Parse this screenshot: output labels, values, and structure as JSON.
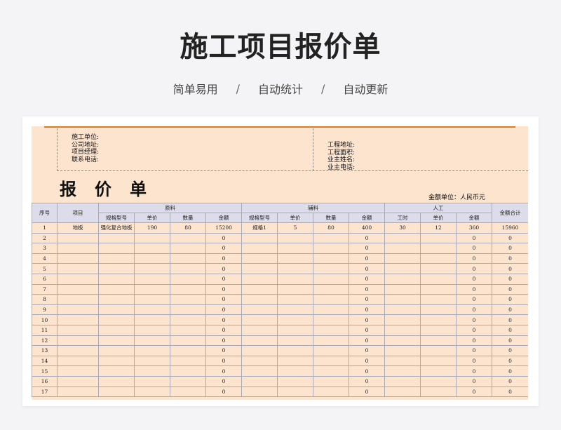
{
  "header": {
    "title": "施工项目报价单",
    "features": [
      "简单易用",
      "自动统计",
      "自动更新"
    ],
    "separator": "/"
  },
  "sheet": {
    "info_left": [
      "施工单位:",
      "公司地址:",
      "项目经理:",
      "联系电话:"
    ],
    "info_right": [
      "工程地址:",
      "工程面积:",
      "业主姓名:",
      "业主电话:"
    ],
    "doc_title": "报价单",
    "currency_unit": "金额单位：人民币元",
    "table": {
      "group_headers": {
        "no": "序号",
        "item": "项目",
        "material": "原料",
        "auxiliary": "辅料",
        "labor": "人工",
        "total": "金额合计"
      },
      "sub_headers": {
        "material": [
          "规格型号",
          "单价",
          "数量",
          "金额"
        ],
        "auxiliary": [
          "规格型号",
          "单价",
          "数量",
          "金额"
        ],
        "labor": [
          "工时",
          "单价",
          "金额"
        ]
      },
      "rows": [
        [
          "1",
          "地板",
          "强化复合地板",
          "190",
          "80",
          "15200",
          "规格1",
          "5",
          "80",
          "400",
          "30",
          "12",
          "360",
          "15960"
        ],
        [
          "2",
          "",
          "",
          "",
          "",
          "0",
          "",
          "",
          "",
          "0",
          "",
          "",
          "0",
          "0"
        ],
        [
          "3",
          "",
          "",
          "",
          "",
          "0",
          "",
          "",
          "",
          "0",
          "",
          "",
          "0",
          "0"
        ],
        [
          "4",
          "",
          "",
          "",
          "",
          "0",
          "",
          "",
          "",
          "0",
          "",
          "",
          "0",
          "0"
        ],
        [
          "5",
          "",
          "",
          "",
          "",
          "0",
          "",
          "",
          "",
          "0",
          "",
          "",
          "0",
          "0"
        ],
        [
          "6",
          "",
          "",
          "",
          "",
          "0",
          "",
          "",
          "",
          "0",
          "",
          "",
          "0",
          "0"
        ],
        [
          "7",
          "",
          "",
          "",
          "",
          "0",
          "",
          "",
          "",
          "0",
          "",
          "",
          "0",
          "0"
        ],
        [
          "8",
          "",
          "",
          "",
          "",
          "0",
          "",
          "",
          "",
          "0",
          "",
          "",
          "0",
          "0"
        ],
        [
          "9",
          "",
          "",
          "",
          "",
          "0",
          "",
          "",
          "",
          "0",
          "",
          "",
          "0",
          "0"
        ],
        [
          "10",
          "",
          "",
          "",
          "",
          "0",
          "",
          "",
          "",
          "0",
          "",
          "",
          "0",
          "0"
        ],
        [
          "11",
          "",
          "",
          "",
          "",
          "0",
          "",
          "",
          "",
          "0",
          "",
          "",
          "0",
          "0"
        ],
        [
          "12",
          "",
          "",
          "",
          "",
          "0",
          "",
          "",
          "",
          "0",
          "",
          "",
          "0",
          "0"
        ],
        [
          "13",
          "",
          "",
          "",
          "",
          "0",
          "",
          "",
          "",
          "0",
          "",
          "",
          "0",
          "0"
        ],
        [
          "14",
          "",
          "",
          "",
          "",
          "0",
          "",
          "",
          "",
          "0",
          "",
          "",
          "0",
          "0"
        ],
        [
          "15",
          "",
          "",
          "",
          "",
          "0",
          "",
          "",
          "",
          "0",
          "",
          "",
          "0",
          "0"
        ],
        [
          "16",
          "",
          "",
          "",
          "",
          "0",
          "",
          "",
          "",
          "0",
          "",
          "",
          "0",
          "0"
        ],
        [
          "17",
          "",
          "",
          "",
          "",
          "0",
          "",
          "",
          "",
          "0",
          "",
          "",
          "0",
          "0"
        ]
      ]
    }
  },
  "colors": {
    "accent_line": "#e07b22",
    "sheet_background": "#fde4cf",
    "header_background": "#dcdcea"
  }
}
